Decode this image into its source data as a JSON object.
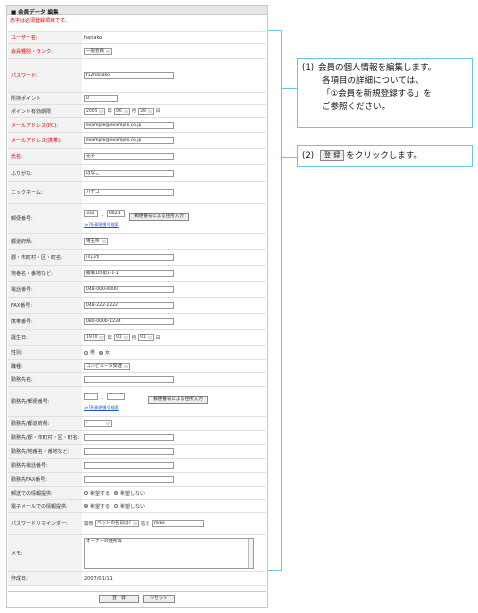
{
  "form": {
    "title": "■ 会員データ 編集",
    "required_note": "赤字は必須登録項目です。",
    "rows": [
      {
        "label": "ユーザー名:",
        "value": "hanako"
      },
      {
        "label": "会員種別・ランク:",
        "select": "一般会員"
      },
      {
        "label": "パスワード:",
        "input": "f12hanako"
      },
      {
        "label": "所持ポイント",
        "input": "0"
      },
      {
        "label": "ポイント有効期限",
        "year": "2005",
        "month": "06",
        "day": "28",
        "unit_year": "年",
        "unit_month": "月",
        "unit_day": "日"
      },
      {
        "label": "メールアドレス(PC):",
        "input": "example@example.co.jp"
      },
      {
        "label": "メールアドレス(携帯):",
        "input": "example@example.co.jp"
      },
      {
        "label": "氏名:",
        "input": "花子"
      },
      {
        "label": "ふりがな:",
        "input": "はなこ"
      },
      {
        "label": "ニックネーム:",
        "input": "ハナコ"
      },
      {
        "label": "郵便番号:",
        "zip1": "332",
        "zip2": "0023",
        "zip_button": "郵便番号による住所入力",
        "zip_link": "≫7桁郵便番号検索"
      },
      {
        "label": "都道府県:",
        "select": "埼玉県"
      },
      {
        "label": "郡・市町村・区・町名:",
        "input": "川口市"
      },
      {
        "label": "地番名・番地など:",
        "input": "飯塚1の街1-1-1"
      },
      {
        "label": "電話番号:",
        "input": "048-000-0000"
      },
      {
        "label": "FAX番号:",
        "input": "048-222-2222"
      },
      {
        "label": "携帯番号:",
        "input": "080-0000-1234"
      },
      {
        "label": "誕生日:",
        "year": "1970",
        "month": "01",
        "day": "01",
        "unit_year": "年",
        "unit_month": "月",
        "unit_day": "日"
      },
      {
        "label": "性別:",
        "opt1": "男",
        "opt2": "女"
      },
      {
        "label": "職種:",
        "select": "コンピュータ関連"
      },
      {
        "label": "勤務先名:",
        "input": ""
      },
      {
        "label": "勤務先/郵便番号:",
        "zip1": "",
        "zip2": "",
        "zip_button": "郵便番号による住所入力",
        "zip_link": "≫7桁郵便番号検索"
      },
      {
        "label": "勤務先/都道府県:",
        "select": "-"
      },
      {
        "label": "勤務先/郡・市町村・区・町名:",
        "input": ""
      },
      {
        "label": "勤務先/地番名・番地など:",
        "input": ""
      },
      {
        "label": "勤務先電話番号:",
        "input": ""
      },
      {
        "label": "勤務先FAX番号:",
        "input": ""
      },
      {
        "label": "郵送での情報提供:",
        "opt1": "希望する",
        "opt2": "希望しない"
      },
      {
        "label": "電子メールでの情報提供:",
        "opt1": "希望する",
        "opt2": "希望しない"
      },
      {
        "label": "パスワードリマインダー:",
        "q_label": "質問",
        "q_select": "ペットの名前は?",
        "a_label": "答え",
        "a_input": "mike"
      },
      {
        "label": "メモ:",
        "textarea": "オーナーの住所等"
      },
      {
        "label": "作成日:",
        "value": "2007/01/11"
      }
    ],
    "register_button": "登　録",
    "reset_button": "リセット"
  },
  "callouts": {
    "c1_num": "(1)",
    "c1_line1": "会員の個人情報を編集します。",
    "c1_line2": "各項目の詳細については、",
    "c1_line3": "「①会員を新規登録する」を",
    "c1_line4": "ご参照ください。",
    "c2_num": "(2)",
    "c2_button": "登 録",
    "c2_text": "をクリックします。"
  },
  "colors": {
    "required_label": "#dd0000",
    "callout_border": "#6cc4e8",
    "link": "#2255cc"
  }
}
